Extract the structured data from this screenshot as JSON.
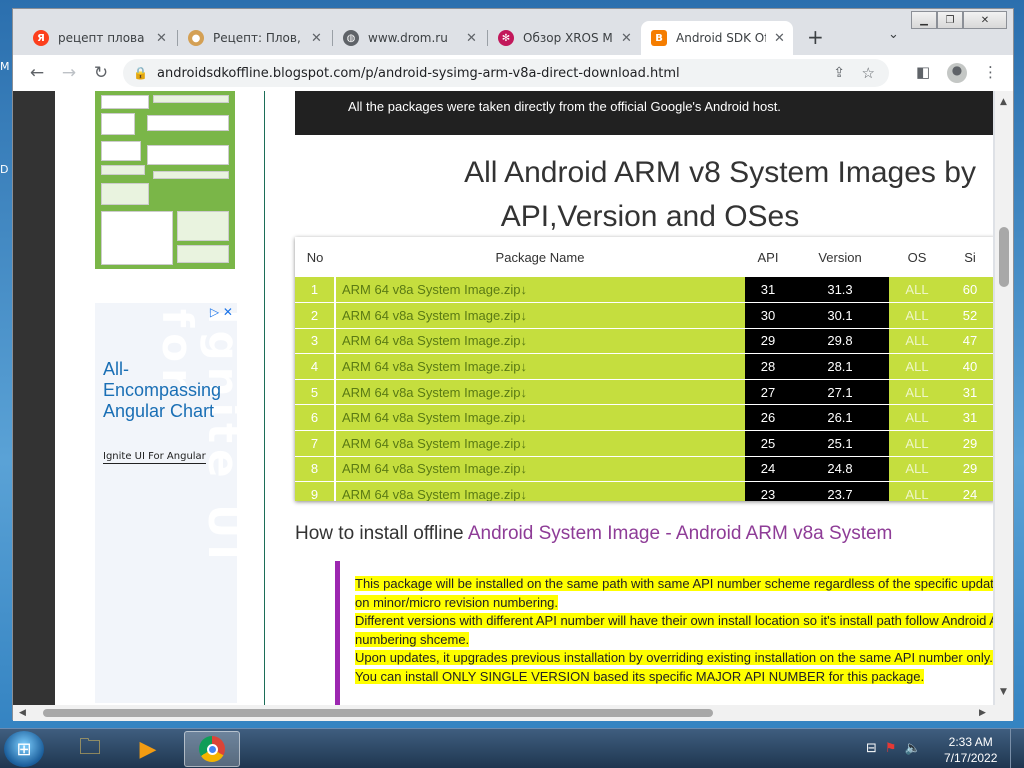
{
  "desktop": {
    "frag_top": "M",
    "frag_mid": "D"
  },
  "browser": {
    "tabs": [
      {
        "title": "рецепт плова —",
        "favicon": "yandex-icon",
        "fav_color": "#fc3f1d",
        "fav_char": "Я",
        "active": false
      },
      {
        "title": "Рецепт: Плов, ко",
        "favicon": "recipe-icon",
        "fav_color": "#d4a054",
        "fav_char": "●",
        "active": false
      },
      {
        "title": "www.drom.ru",
        "favicon": "globe-icon",
        "fav_color": "#5f6368",
        "fav_char": "◍",
        "active": false
      },
      {
        "title": "Обзор XROS MIN",
        "favicon": "xros-icon",
        "fav_color": "#c2185b",
        "fav_char": "✻",
        "active": false
      },
      {
        "title": "Android SDK Off",
        "favicon": "blogger-icon",
        "fav_color": "#f57d00",
        "fav_char": "B",
        "active": true
      }
    ],
    "url": "androidsdkoffline.blogspot.com/p/android-sysimg-arm-v8a-direct-download.html"
  },
  "page": {
    "top_bar_text": "All the packages were taken directly from the official Google's Android host.",
    "heading_line1": "All Android ARM v8 System Images by",
    "heading_line2": "API,Version and OSes",
    "table": {
      "headers": [
        "No",
        "Package Name",
        "API",
        "Version",
        "OS",
        "Si"
      ],
      "rows": [
        {
          "no": "1",
          "name": "ARM 64 v8a System Image.zip↓",
          "api": "31",
          "version": "31.3",
          "os": "ALL",
          "size": "60"
        },
        {
          "no": "2",
          "name": "ARM 64 v8a System Image.zip↓",
          "api": "30",
          "version": "30.1",
          "os": "ALL",
          "size": "52"
        },
        {
          "no": "3",
          "name": "ARM 64 v8a System Image.zip↓",
          "api": "29",
          "version": "29.8",
          "os": "ALL",
          "size": "47"
        },
        {
          "no": "4",
          "name": "ARM 64 v8a System Image.zip↓",
          "api": "28",
          "version": "28.1",
          "os": "ALL",
          "size": "40"
        },
        {
          "no": "5",
          "name": "ARM 64 v8a System Image.zip↓",
          "api": "27",
          "version": "27.1",
          "os": "ALL",
          "size": "31"
        },
        {
          "no": "6",
          "name": "ARM 64 v8a System Image.zip↓",
          "api": "26",
          "version": "26.1",
          "os": "ALL",
          "size": "31"
        },
        {
          "no": "7",
          "name": "ARM 64 v8a System Image.zip↓",
          "api": "25",
          "version": "25.1",
          "os": "ALL",
          "size": "29"
        },
        {
          "no": "8",
          "name": "ARM 64 v8a System Image.zip↓",
          "api": "24",
          "version": "24.8",
          "os": "ALL",
          "size": "29"
        },
        {
          "no": "9",
          "name": "ARM 64 v8a System Image.zip↓",
          "api": "23",
          "version": "23.7",
          "os": "ALL",
          "size": "24"
        }
      ]
    },
    "install_heading": "How to install offline ",
    "install_link": "Android System Image - Android ARM v8a System",
    "notes": [
      "This package will be installed on the same path with same API number scheme regardless of the specific updates on minor/micro revision numbering.",
      "Different versions with different API number will have their own install location so it's install path follow Android API numbering shceme.",
      "Upon updates, it upgrades previous installation by overriding existing installation on the same API number only.",
      "You can install ONLY SINGLE VERSION based its specific MAJOR API NUMBER for this package."
    ]
  },
  "ad": {
    "headline": "All-Encompassing Angular Chart",
    "cta": "Ignite UI For Angular",
    "watermark1": "Ignite UI",
    "watermark2": "for"
  },
  "taskbar": {
    "time": "2:33 AM",
    "date": "7/17/2022"
  }
}
